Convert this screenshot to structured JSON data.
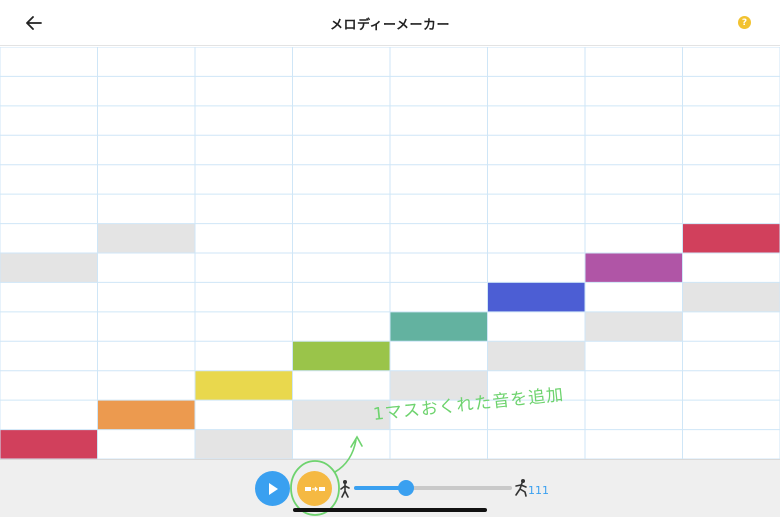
{
  "header": {
    "title": "メロディーメーカー",
    "back_icon": "arrow-left-icon",
    "help_icon": "question-icon",
    "help_glyph": "?"
  },
  "grid": {
    "columns": 8,
    "rows": 14,
    "line_color": "#cfe6f7",
    "placeholder_color": "#e4e4e4",
    "notes": [
      {
        "col": 0,
        "row": 13,
        "color": "#d1405c"
      },
      {
        "col": 1,
        "row": 12,
        "color": "#ec9a4f"
      },
      {
        "col": 2,
        "row": 11,
        "color": "#e9d84d"
      },
      {
        "col": 3,
        "row": 10,
        "color": "#9ac44a"
      },
      {
        "col": 4,
        "row": 9,
        "color": "#63b2a0"
      },
      {
        "col": 5,
        "row": 8,
        "color": "#4c5ed4"
      },
      {
        "col": 6,
        "row": 7,
        "color": "#b055a6"
      },
      {
        "col": 7,
        "row": 6,
        "color": "#d1405c"
      }
    ],
    "placeholders": [
      {
        "col": 0,
        "row": 7
      },
      {
        "col": 1,
        "row": 6
      },
      {
        "col": 2,
        "row": 13
      },
      {
        "col": 3,
        "row": 12
      },
      {
        "col": 4,
        "row": 11
      },
      {
        "col": 5,
        "row": 10
      },
      {
        "col": 6,
        "row": 9
      },
      {
        "col": 7,
        "row": 8
      }
    ]
  },
  "controls": {
    "play_icon": "play-icon",
    "add_icon": "shift-notes-icon",
    "slow_icon": "walking-person-icon",
    "fast_icon": "running-person-icon",
    "tempo_fraction": 0.33,
    "tempo_value": "111",
    "accent": "#3aa0f0",
    "add_color": "#f5b942"
  },
  "annotation": {
    "text": "1マスおくれた音を追加",
    "color": "#6ed36e"
  }
}
